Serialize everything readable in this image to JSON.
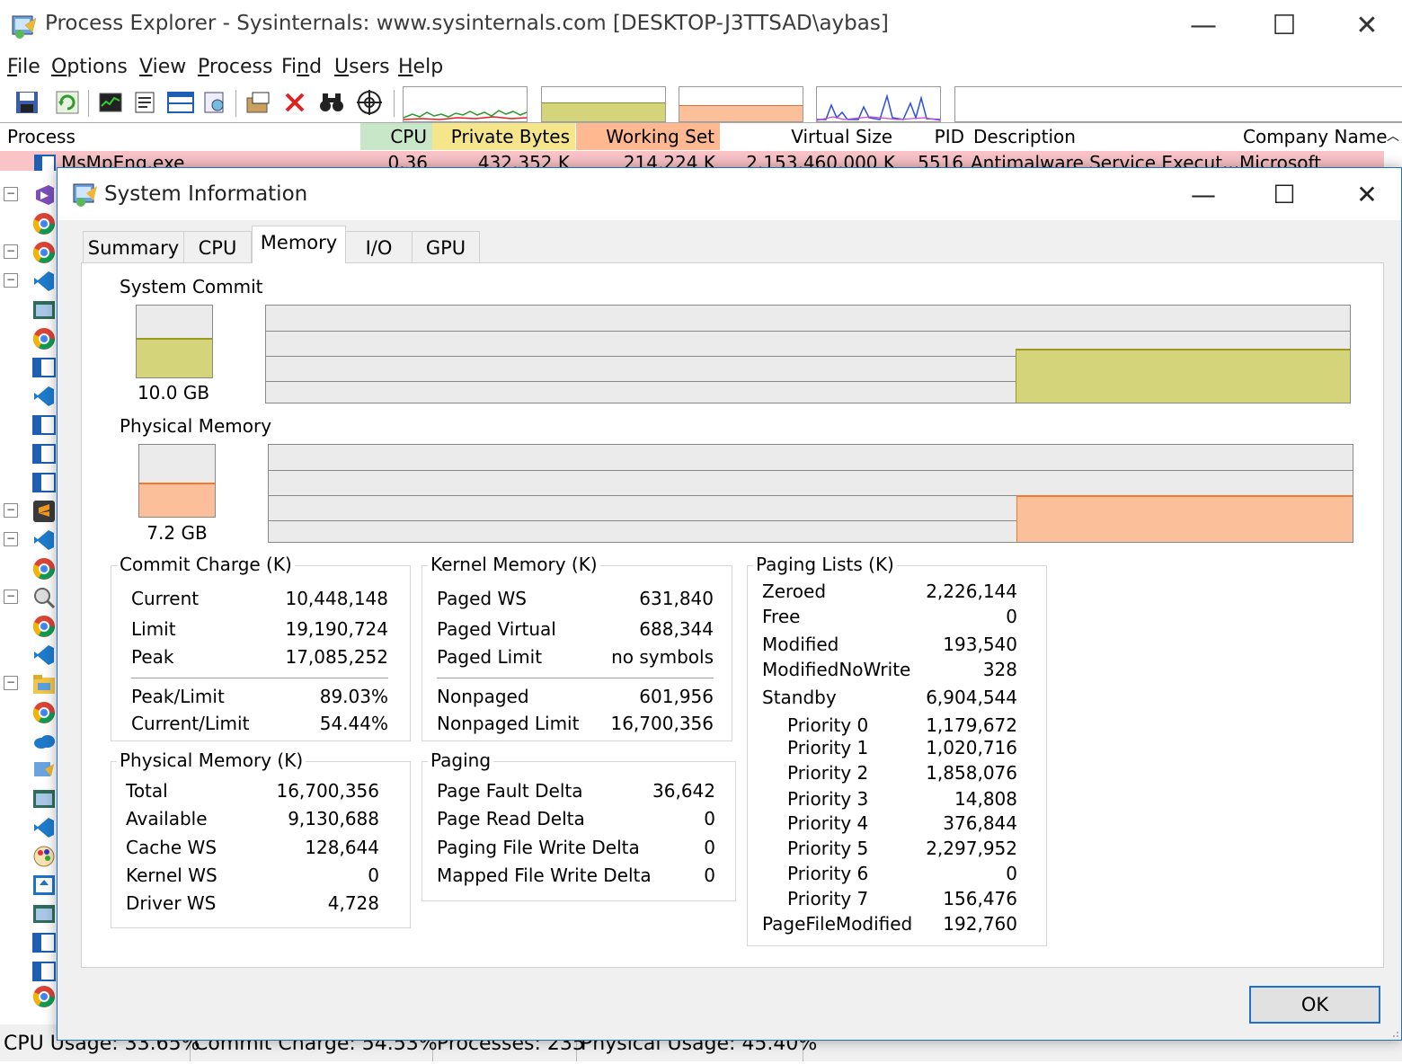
{
  "window": {
    "title": "Process Explorer - Sysinternals: www.sysinternals.com [DESKTOP-J3TTSAD\\aybas]",
    "minimize_glyph": "—",
    "maximize_glyph": "☐",
    "close_glyph": "✕"
  },
  "menu": [
    {
      "accel": "F",
      "rest": "ile"
    },
    {
      "accel": "O",
      "rest": "ptions"
    },
    {
      "accel": "V",
      "rest": "iew"
    },
    {
      "accel": "P",
      "rest": "rocess"
    },
    {
      "pre": "Fi",
      "accel": "n",
      "rest": "d"
    },
    {
      "accel": "U",
      "rest": "sers"
    },
    {
      "accel": "H",
      "rest": "elp"
    }
  ],
  "toolbar_icons": [
    "save-icon",
    "refresh-icon",
    "system-info-icon",
    "properties-icon",
    "lower-pane-icon",
    "dll-icon",
    "handle-icon",
    "kill-process-icon",
    "find-icon",
    "target-icon"
  ],
  "columns": {
    "process": "Process",
    "cpu": "CPU",
    "private_bytes": "Private Bytes",
    "working_set": "Working Set",
    "virtual_size": "Virtual Size",
    "pid": "PID",
    "description": "Description",
    "company": "Company Name"
  },
  "first_row": {
    "process": "MsMpEng.exe",
    "cpu": "0.36",
    "private_bytes": "432,352 K",
    "working_set": "214,224 K",
    "virtual_size": "2,153,460,000 K",
    "pid": "5516",
    "description": "Antimalware Service Execut...",
    "company": "Microsoft Corpor..."
  },
  "status": {
    "cpu": "CPU Usage: 33.65%",
    "commit": "Commit Charge: 54.53%",
    "processes": "Processes: 235",
    "physical": "Physical Usage: 45.40%"
  },
  "dialog": {
    "title": "System Information",
    "tabs": [
      "Summary",
      "CPU",
      "Memory",
      "I/O",
      "GPU"
    ],
    "active_tab": "Memory",
    "ok_label": "OK",
    "system_commit": {
      "label": "System Commit",
      "value": "10.0 GB",
      "fill_fraction": 0.52,
      "history_level": 0.54,
      "color": "#d4d47a"
    },
    "physical_memory": {
      "label": "Physical Memory",
      "value": "7.2 GB",
      "fill_fraction": 0.45,
      "history_level": 0.46,
      "color": "#fbbf9a"
    },
    "commit_charge": {
      "title": "Commit Charge (K)",
      "rows": [
        {
          "k": "Current",
          "v": "10,448,148"
        },
        {
          "k": "Limit",
          "v": "19,190,724"
        },
        {
          "k": "Peak",
          "v": "17,085,252"
        },
        {
          "k": "Peak/Limit",
          "v": "89.03%"
        },
        {
          "k": "Current/Limit",
          "v": "54.44%"
        }
      ]
    },
    "kernel_memory": {
      "title": "Kernel Memory (K)",
      "rows": [
        {
          "k": "Paged WS",
          "v": "631,840"
        },
        {
          "k": "Paged Virtual",
          "v": "688,344"
        },
        {
          "k": "Paged Limit",
          "v": "no symbols"
        },
        {
          "k": "Nonpaged",
          "v": "601,956"
        },
        {
          "k": "Nonpaged Limit",
          "v": "16,700,356"
        }
      ]
    },
    "paging_lists": {
      "title": "Paging Lists (K)",
      "rows": [
        {
          "k": "Zeroed",
          "v": "2,226,144"
        },
        {
          "k": "Free",
          "v": "0"
        },
        {
          "k": "Modified",
          "v": "193,540"
        },
        {
          "k": "ModifiedNoWrite",
          "v": "328"
        },
        {
          "k": "Standby",
          "v": "6,904,544"
        },
        {
          "k": "Priority 0",
          "v": "1,179,672"
        },
        {
          "k": "Priority 1",
          "v": "1,020,716"
        },
        {
          "k": "Priority 2",
          "v": "1,858,076"
        },
        {
          "k": "Priority 3",
          "v": "14,808"
        },
        {
          "k": "Priority 4",
          "v": "376,844"
        },
        {
          "k": "Priority 5",
          "v": "2,297,952"
        },
        {
          "k": "Priority 6",
          "v": "0"
        },
        {
          "k": "Priority 7",
          "v": "156,476"
        },
        {
          "k": "PageFileModified",
          "v": "192,760"
        }
      ]
    },
    "physical_memory_k": {
      "title": "Physical Memory (K)",
      "rows": [
        {
          "k": "Total",
          "v": "16,700,356"
        },
        {
          "k": "Available",
          "v": "9,130,688"
        },
        {
          "k": "Cache WS",
          "v": "128,644"
        },
        {
          "k": "Kernel WS",
          "v": "0"
        },
        {
          "k": "Driver WS",
          "v": "4,728"
        }
      ]
    },
    "paging": {
      "title": "Paging",
      "rows": [
        {
          "k": "Page Fault Delta",
          "v": "36,642"
        },
        {
          "k": "Page Read Delta",
          "v": "0"
        },
        {
          "k": "Paging File Write Delta",
          "v": "0"
        },
        {
          "k": "Mapped File Write Delta",
          "v": "0"
        }
      ]
    }
  },
  "colors": {
    "cpu_header": "#c8e6c8",
    "private_header": "#f5e68c",
    "working_header": "#ffb890",
    "row_highlight": "#f9c3c8",
    "accent": "#1e73c8"
  }
}
